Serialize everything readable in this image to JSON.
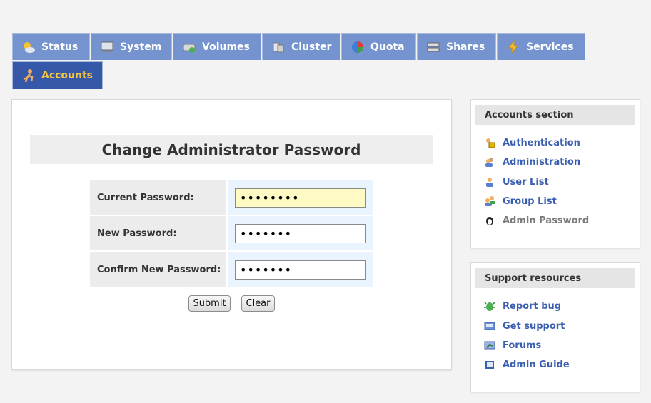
{
  "tabs": [
    {
      "label": "Status",
      "icon": "weather-sun-icon"
    },
    {
      "label": "System",
      "icon": "monitor-icon"
    },
    {
      "label": "Volumes",
      "icon": "drive-icon"
    },
    {
      "label": "Cluster",
      "icon": "cluster-icon"
    },
    {
      "label": "Quota",
      "icon": "pie-chart-icon"
    },
    {
      "label": "Shares",
      "icon": "server-icon"
    },
    {
      "label": "Services",
      "icon": "lightning-icon"
    },
    {
      "label": "Accounts",
      "icon": "user-run-icon"
    }
  ],
  "active_tab": "Accounts",
  "main": {
    "title": "Change Administrator Password",
    "fields": [
      {
        "label": "Current Password:",
        "value": "••••••••"
      },
      {
        "label": "New Password:",
        "value": "•••••••"
      },
      {
        "label": "Confirm New Password:",
        "value": "•••••••"
      }
    ],
    "submit_label": "Submit",
    "clear_label": "Clear"
  },
  "accounts_section": {
    "heading": "Accounts section",
    "links": [
      {
        "label": "Authentication",
        "icon": "lock-user-icon"
      },
      {
        "label": "Administration",
        "icon": "users-icon"
      },
      {
        "label": "User List",
        "icon": "user-icon"
      },
      {
        "label": "Group List",
        "icon": "group-icon"
      },
      {
        "label": "Admin Password",
        "icon": "penguin-icon"
      }
    ]
  },
  "support_resources": {
    "heading": "Support resources",
    "links": [
      {
        "label": "Report bug",
        "icon": "bug-icon"
      },
      {
        "label": "Get support",
        "icon": "support-icon"
      },
      {
        "label": "Forums",
        "icon": "forum-icon"
      },
      {
        "label": "Admin Guide",
        "icon": "book-icon"
      }
    ]
  },
  "colors": {
    "tab_bg": "#7493cf",
    "tab_active_bg": "#3559a8",
    "tab_active_text": "#f6c542",
    "link": "#3b5fb0",
    "input_focus": "#fff9c4"
  }
}
